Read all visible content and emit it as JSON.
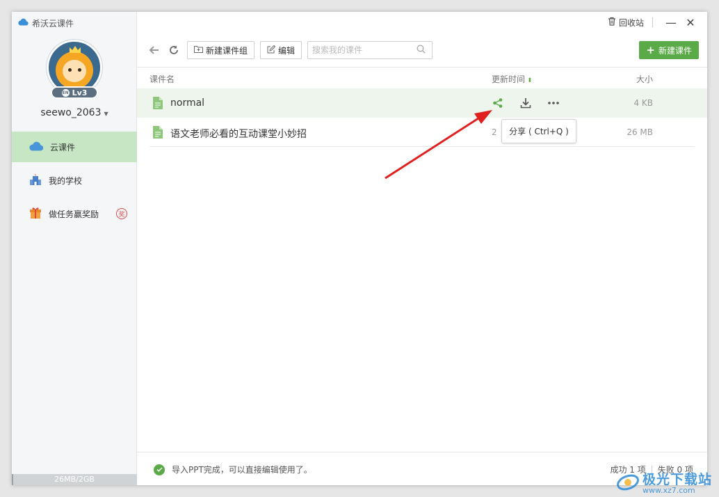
{
  "app": {
    "title": "希沃云课件"
  },
  "profile": {
    "level": "Lv3",
    "username": "seewo_2063"
  },
  "sidebar": {
    "items": [
      {
        "label": "云课件",
        "icon": "cloud-icon",
        "active": true
      },
      {
        "label": "我的学校",
        "icon": "school-icon",
        "active": false
      },
      {
        "label": "做任务赢奖励",
        "icon": "gift-icon",
        "active": false,
        "badge": "奖"
      }
    ],
    "storage": {
      "label": "26MB/2GB",
      "used_fraction": 0.013
    }
  },
  "titlebar": {
    "recycle_label": "回收站",
    "minimize": "—",
    "close": "✕"
  },
  "toolbar": {
    "new_group_label": "新建课件组",
    "edit_label": "编辑",
    "search_placeholder": "搜索我的课件",
    "new_courseware_label": "新建课件"
  },
  "table": {
    "headers": {
      "name": "课件名",
      "time": "更新时间",
      "size": "大小"
    },
    "rows": [
      {
        "name": "normal",
        "time": "",
        "size": "4 KB"
      },
      {
        "name": "语文老师必看的互动课堂小妙招",
        "time": "2",
        "size": "26 MB"
      }
    ]
  },
  "tooltip": {
    "text": "分享 ( Ctrl+Q )"
  },
  "footer": {
    "message": "导入PPT完成，可以直接编辑使用了。",
    "success": "成功 1 项",
    "fail": "失败 0 项"
  },
  "watermark": {
    "title": "极光下载站",
    "url": "www.xz7.com"
  },
  "colors": {
    "accent": "#5aaa47",
    "active_nav": "#c6e6c4",
    "row_highlight": "#eef5ec",
    "arrow": "#e02020"
  }
}
